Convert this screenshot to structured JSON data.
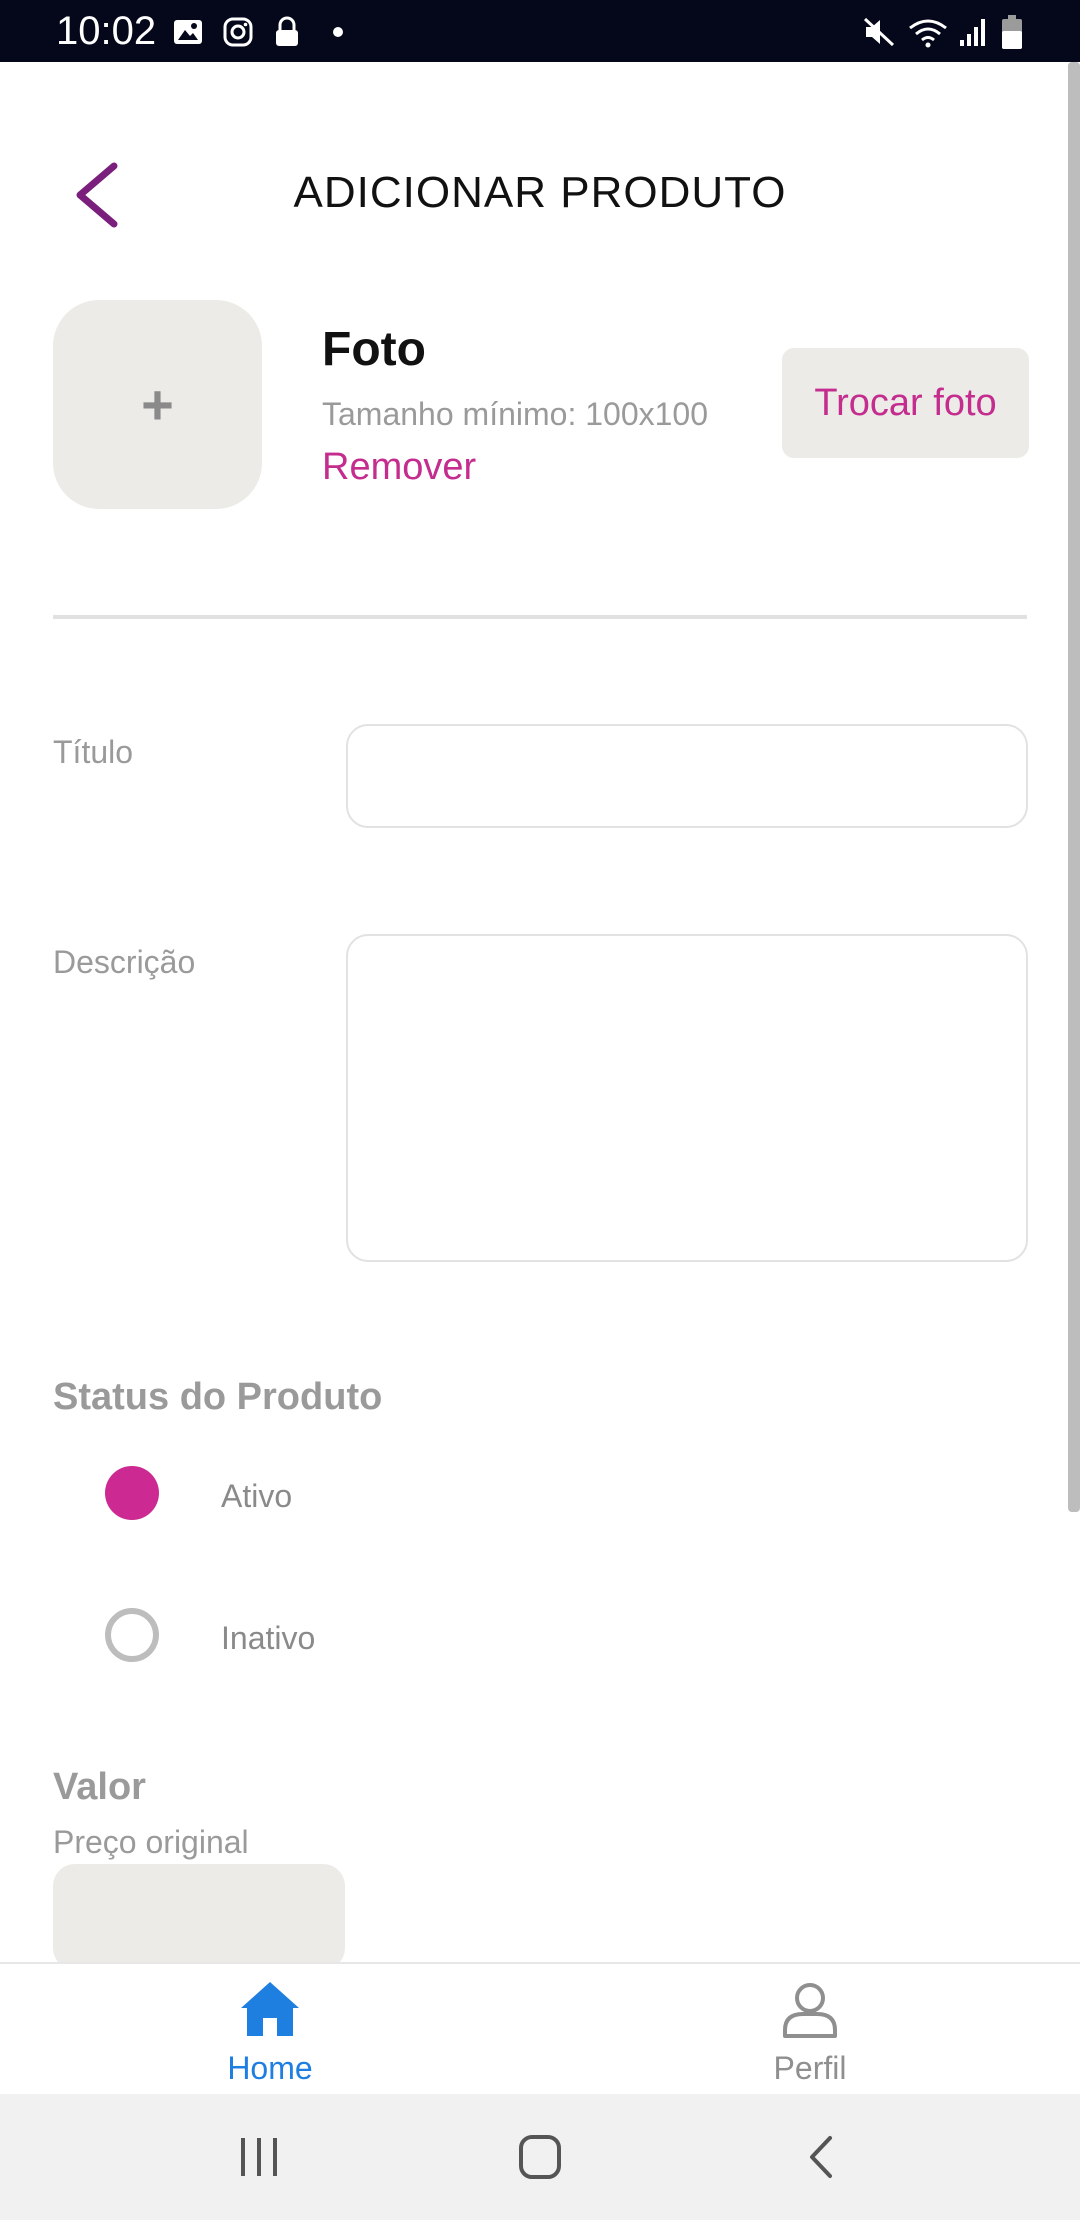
{
  "status_bar": {
    "time": "10:02",
    "left_icons": [
      "image-icon",
      "instagram-icon",
      "lock-icon"
    ],
    "right_icons": [
      "mute-icon",
      "wifi-icon",
      "signal-icon",
      "battery-icon"
    ]
  },
  "header": {
    "title": "ADICIONAR PRODUTO",
    "accent_color": "#7a1f7c"
  },
  "photo": {
    "placeholder_symbol": "+",
    "title": "Foto",
    "hint": "Tamanho mínimo: 100x100",
    "remove_label": "Remover",
    "change_label": "Trocar foto",
    "link_color": "#c42c8e"
  },
  "form": {
    "title_label": "Título",
    "title_value": "",
    "description_label": "Descrição",
    "description_value": ""
  },
  "status": {
    "heading": "Status do Produto",
    "options": [
      {
        "label": "Ativo",
        "selected": true
      },
      {
        "label": "Inativo",
        "selected": false
      }
    ],
    "selected_color": "#cc2a92"
  },
  "price": {
    "heading": "Valor",
    "original_label": "Preço original",
    "original_value": ""
  },
  "tabs": [
    {
      "label": "Home",
      "icon": "home-icon",
      "active": true,
      "color": "#1e7fe0"
    },
    {
      "label": "Perfil",
      "icon": "user-icon",
      "active": false,
      "color": "#8f8f8f"
    }
  ],
  "nav_bar": {
    "buttons": [
      "recent-apps-icon",
      "home-circle-icon",
      "back-chevron-icon"
    ]
  }
}
